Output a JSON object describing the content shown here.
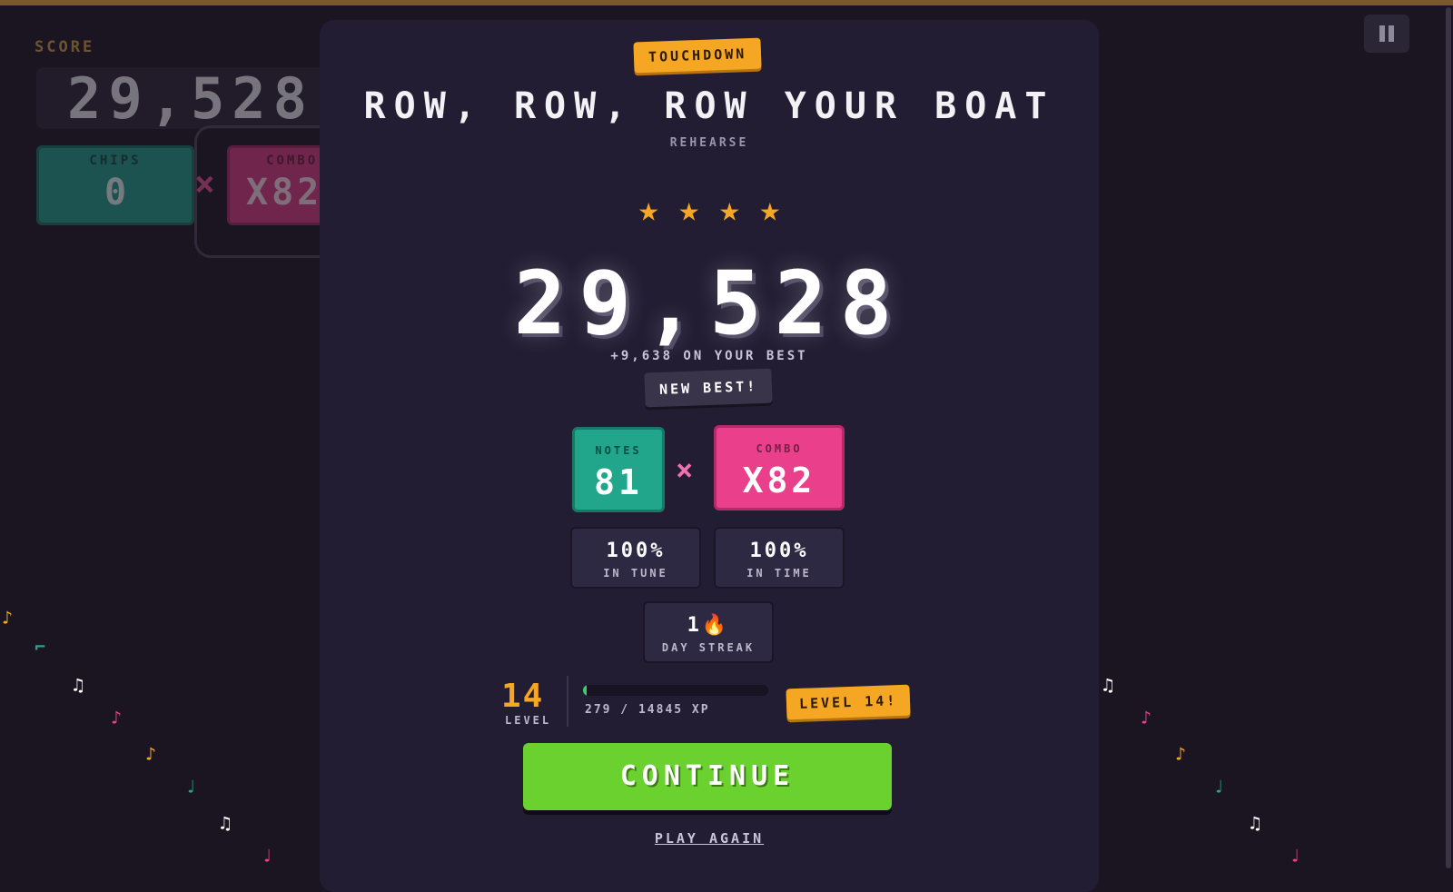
{
  "hud": {
    "score_label": "SCORE",
    "score_value": "29,528",
    "chips_label": "CHIPS",
    "chips_value": "0",
    "multiply_symbol": "×",
    "combo_label": "COMBO",
    "combo_value": "X82"
  },
  "pause": {
    "icon": "pause-icon"
  },
  "results": {
    "badge": "TOUCHDOWN",
    "song_title": "ROW, ROW, ROW YOUR BOAT",
    "mode": "REHEARSE",
    "stars": [
      "★",
      "★",
      "★",
      "★"
    ],
    "score": "29,528",
    "delta": "+9,638 ON YOUR BEST",
    "new_best": "NEW BEST!",
    "notes_label": "NOTES",
    "notes_value": "81",
    "multiply_symbol": "×",
    "combo_label": "COMBO",
    "combo_value": "X82",
    "in_tune_value": "100%",
    "in_tune_label": "IN TUNE",
    "in_time_value": "100%",
    "in_time_label": "IN TIME",
    "streak_value": "1",
    "streak_icon": "🔥",
    "streak_label": "DAY STREAK",
    "level_value": "14",
    "level_label": "LEVEL",
    "xp_text": "279 / 14845 XP",
    "xp_fraction": 0.0188,
    "level_up": "LEVEL 14!",
    "continue_label": "CONTINUE",
    "play_again_label": "PLAY AGAIN"
  },
  "colors": {
    "accent_orange": "#f5a623",
    "notes_teal": "#21a58b",
    "combo_pink": "#ea3f8a",
    "continue_green": "#6bd12f"
  }
}
